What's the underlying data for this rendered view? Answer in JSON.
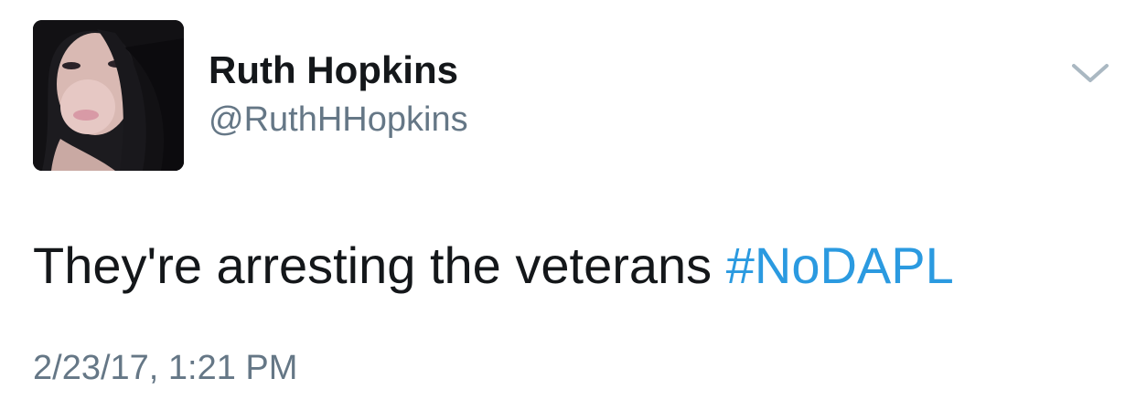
{
  "tweet": {
    "author": {
      "display_name": "Ruth Hopkins",
      "handle": "@RuthHHopkins",
      "avatar_icon": "profile-photo"
    },
    "menu_icon": "chevron-down-icon",
    "text_before_hashtag": "They're arresting the veterans ",
    "hashtag": "#NoDAPL",
    "timestamp": "2/23/17, 1:21 PM"
  },
  "colors": {
    "name": "#14171a",
    "secondary": "#657786",
    "link": "#2b9ae0",
    "caret": "#aab8c2"
  }
}
